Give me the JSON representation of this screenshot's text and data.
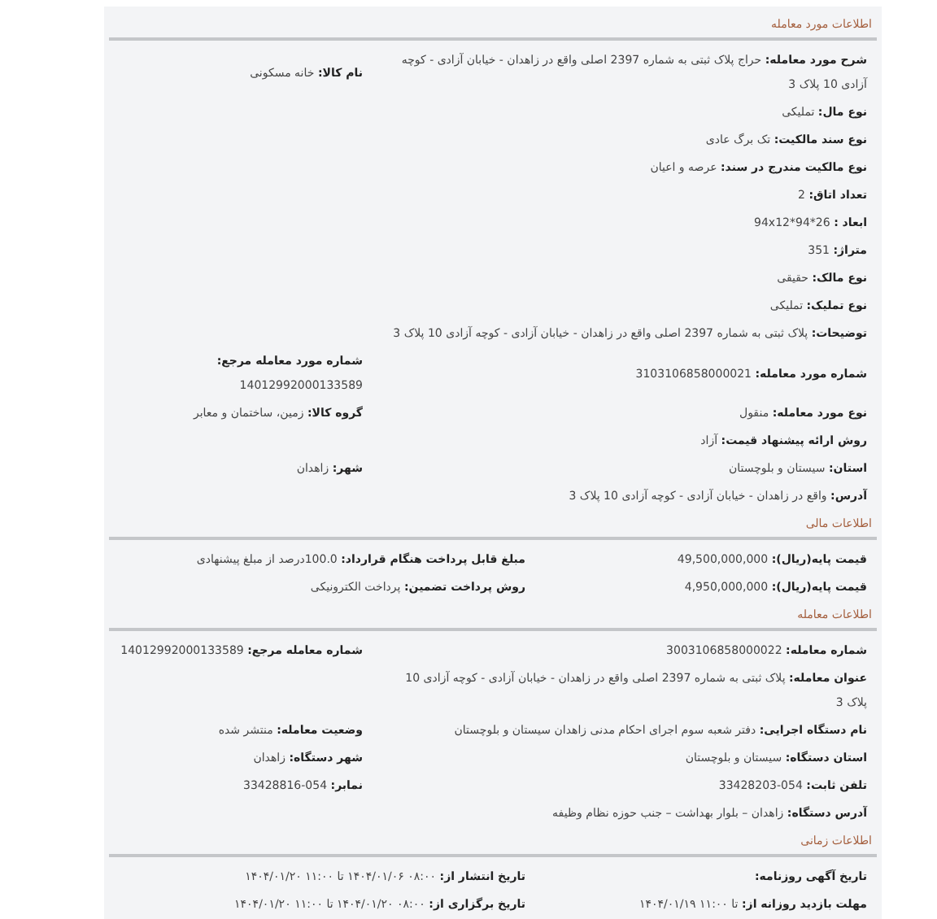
{
  "sections": [
    {
      "title": "اطلاعات مورد معامله",
      "rows": [
        {
          "fields": [
            {
              "label": "شرح مورد معامله:",
              "value": "حراج پلاک ثبتی به شماره 2397 اصلی واقع در زاهدان - خیابان آزادی - کوچه آزادی 10 پلاک 3"
            },
            {
              "label": "نام کالا:",
              "value": "خانه مسکونی"
            }
          ]
        },
        {
          "fields": [
            {
              "label": "نوع مال:",
              "value": "تملیکی"
            }
          ]
        },
        {
          "fields": [
            {
              "label": "نوع سند مالکیت:",
              "value": "تک برگ عادی"
            }
          ]
        },
        {
          "fields": [
            {
              "label": "نوع مالکیت مندرج در سند:",
              "value": "عرصه و اعیان"
            }
          ]
        },
        {
          "fields": [
            {
              "label": "تعداد اتاق:",
              "value": "2"
            }
          ]
        },
        {
          "fields": [
            {
              "label": "ابعاد :",
              "value": "26*94*94x12"
            }
          ]
        },
        {
          "fields": [
            {
              "label": "متراژ:",
              "value": "351"
            }
          ]
        },
        {
          "fields": [
            {
              "label": "نوع مالک:",
              "value": "حقیقی"
            }
          ]
        },
        {
          "fields": [
            {
              "label": "نوع تملیک:",
              "value": "تملیکی"
            }
          ]
        },
        {
          "fields": [
            {
              "label": "توضیحات:",
              "value": "پلاک ثبتی به شماره 2397 اصلی واقع در زاهدان - خیابان آزادی - کوچه آزادی 10 پلاک 3"
            }
          ]
        },
        {
          "fields": [
            {
              "label": "شماره مورد معامله:",
              "value": "3103106858000021"
            },
            {
              "label": "شماره مورد معامله مرجع:",
              "value": "14012992000133589"
            }
          ]
        },
        {
          "fields": [
            {
              "label": "نوع مورد معامله:",
              "value": "منقول"
            },
            {
              "label": "گروه کالا:",
              "value": "زمین، ساختمان و معابر"
            }
          ]
        },
        {
          "fields": [
            {
              "label": "روش ارائه پیشنهاد قیمت:",
              "value": "آزاد"
            }
          ]
        },
        {
          "fields": [
            {
              "label": "استان:",
              "value": "سیستان و بلوچستان"
            },
            {
              "label": "شهر:",
              "value": "زاهدان"
            }
          ]
        },
        {
          "fields": [
            {
              "label": "آدرس:",
              "value": "واقع در زاهدان - خیابان آزادی - کوچه آزادی 10 پلاک 3"
            }
          ]
        }
      ]
    },
    {
      "title": "اطلاعات مالی",
      "rows": [
        {
          "fields": [
            {
              "label": "قیمت پایه(ریال):",
              "value": "49,500,000,000"
            },
            {
              "label": "مبلغ قابل پرداخت هنگام قرارداد:",
              "value": "100.0درصد از مبلغ پیشنهادی"
            }
          ]
        },
        {
          "fields": [
            {
              "label": "قیمت پایه(ریال):",
              "value": "4,950,000,000"
            },
            {
              "label": "روش پرداخت تضمین:",
              "value": "پرداخت الکترونیکی"
            }
          ]
        }
      ]
    },
    {
      "title": "اطلاعات معامله",
      "rows": [
        {
          "fields": [
            {
              "label": "شماره معامله:",
              "value": "3003106858000022"
            },
            {
              "label": "شماره معامله مرجع:",
              "value": "14012992000133589"
            }
          ]
        },
        {
          "fields": [
            {
              "label": "عنوان معامله:",
              "value": "پلاک ثبتی به شماره 2397 اصلی واقع در زاهدان - خیابان آزادی - کوچه آزادی 10 پلاک 3"
            }
          ]
        },
        {
          "fields": [
            {
              "label": "نام دستگاه اجرایی:",
              "value": "دفتر شعبه سوم اجرای احکام مدنی زاهدان سیستان و بلوچستان"
            },
            {
              "label": "وضعیت معامله:",
              "value": "منتشر شده"
            }
          ]
        },
        {
          "fields": [
            {
              "label": "استان دستگاه:",
              "value": "سیستان و بلوچستان"
            },
            {
              "label": "شهر دستگاه:",
              "value": "زاهدان"
            }
          ]
        },
        {
          "fields": [
            {
              "label": "تلفن ثابت:",
              "value": "054-33428203"
            },
            {
              "label": "نمابر:",
              "value": "054-33428816"
            }
          ]
        },
        {
          "fields": [
            {
              "label": "آدرس دستگاه:",
              "value": "زاهدان – بلوار بهداشت – جنب حوزه نظام وظیفه"
            }
          ]
        }
      ]
    },
    {
      "title": "اطلاعات زمانی",
      "rows": [
        {
          "fields": [
            {
              "label": "تاریخ آگهی روزنامه:"
            },
            {
              "label": "تاریخ انتشار از:",
              "value": "۰۸:۰۰ ۱۴۰۴/۰۱/۰۶ تا ۱۱:۰۰ ۱۴۰۴/۰۱/۲۰"
            }
          ]
        },
        {
          "fields": [
            {
              "label": "مهلت بازدید روزانه از:",
              "value": "تا ۱۱:۰۰ ۱۴۰۴/۰۱/۱۹"
            },
            {
              "label": "تاریخ برگزاری از:",
              "value": "۰۸:۰۰ ۱۴۰۴/۰۱/۲۰ تا ۱۱:۰۰ ۱۴۰۴/۰۱/۲۰"
            }
          ]
        }
      ]
    }
  ]
}
